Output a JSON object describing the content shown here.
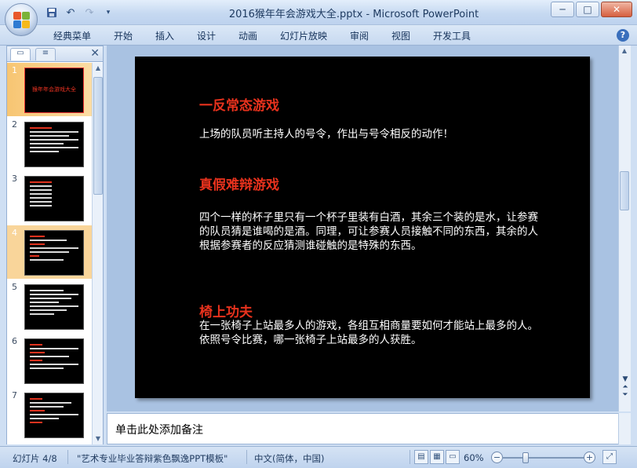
{
  "window": {
    "title": "2016猴年年会游戏大全.pptx - Microsoft PowerPoint",
    "minimize": "─",
    "maximize": "□",
    "close": "✕"
  },
  "qat": [
    "save-icon",
    "undo-icon",
    "redo-icon",
    "customize-icon"
  ],
  "ribbon": {
    "tabs": [
      "经典菜单",
      "开始",
      "插入",
      "设计",
      "动画",
      "幻灯片放映",
      "审阅",
      "视图",
      "开发工具"
    ],
    "help": "?"
  },
  "thumbnails": {
    "items": [
      {
        "num": "1",
        "caption": "猴年年会游戏大全"
      },
      {
        "num": "2"
      },
      {
        "num": "3"
      },
      {
        "num": "4"
      },
      {
        "num": "5"
      },
      {
        "num": "6"
      },
      {
        "num": "7"
      }
    ],
    "selected_index": 3
  },
  "slide": {
    "sections": [
      {
        "title": "一反常态游戏",
        "body": "上场的队员听主持人的号令，作出与号令相反的动作！"
      },
      {
        "title": "真假难辩游戏",
        "body": "四个一样的杯子里只有一个杯子里装有白酒，其余三个装的是水，让参赛的队员猜是谁喝的是酒。同理，可让参赛人员接触不同的东西，其余的人根据参赛者的反应猜测谁碰触的是特殊的东西。"
      },
      {
        "title": "椅上功夫",
        "body": "在一张椅子上站最多人的游戏，各组互相商量要如何才能站上最多的人。依照号令比赛，哪一张椅子上站最多的人获胜。"
      }
    ],
    "colors": {
      "background": "#000000",
      "title": "#e8321d",
      "body": "#ffffff"
    }
  },
  "notes": {
    "placeholder": "单击此处添加备注"
  },
  "status": {
    "slide_info": "幻灯片 4/8",
    "theme": "\"艺术专业毕业答辩紫色飘逸PPT模板\"",
    "language": "中文(简体，中国)",
    "zoom": "60%"
  }
}
